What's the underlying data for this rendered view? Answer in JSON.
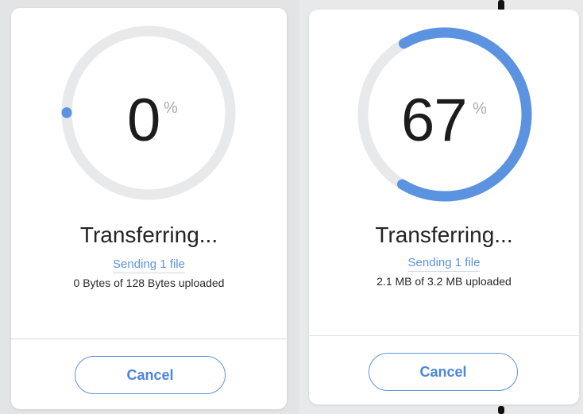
{
  "dialogs": [
    {
      "percent": "0",
      "percent_sign": "%",
      "progress": 0,
      "title": "Transferring...",
      "sending": "Sending 1 file",
      "uploaded": "0 Bytes of 128 Bytes uploaded",
      "cancel_label": "Cancel"
    },
    {
      "percent": "67",
      "percent_sign": "%",
      "progress": 0.67,
      "title": "Transferring...",
      "sending": "Sending 1 file",
      "uploaded": "2.1 MB of 3.2 MB uploaded",
      "cancel_label": "Cancel"
    }
  ],
  "colors": {
    "accent": "#5b93e0",
    "track": "#e8e9eb",
    "text": "#1c1c1c"
  }
}
